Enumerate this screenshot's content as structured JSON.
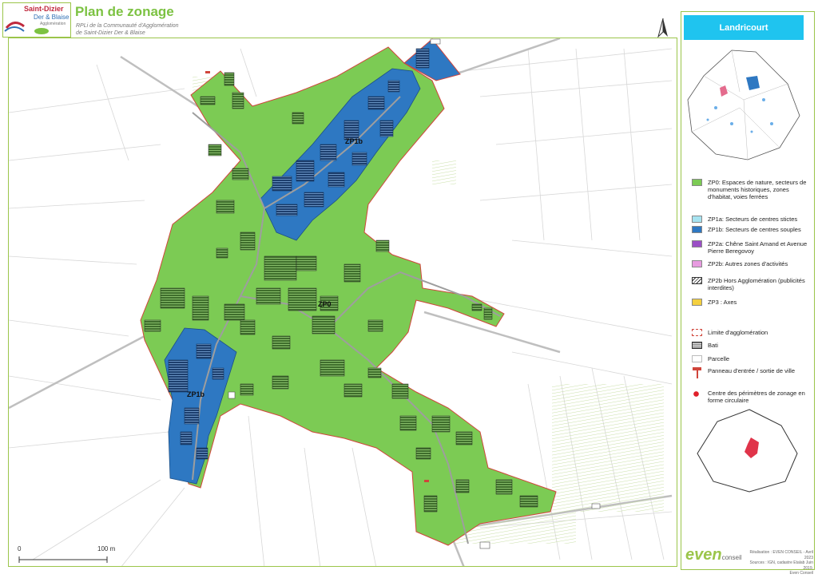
{
  "logo": {
    "line1": "Saint-Dizier",
    "line2": "Der & Blaise",
    "line3": "Agglomération"
  },
  "header": {
    "title": "Plan de zonage",
    "subtitle_line1": "RPLi de la Communauté d'Agglomération",
    "subtitle_line2": "de Saint-Dizier Der & Blaise"
  },
  "north_label": "N",
  "commune_name": "Landricourt",
  "map_labels": {
    "zp1b_top": "ZP1b",
    "zp0": "ZP0",
    "zp1b_bottom": "ZP1b"
  },
  "legend": [
    {
      "label": "ZP0: Espaces de nature, secteurs de monuments historiques, zones d'habitat, voies ferrées",
      "color": "#7ccb54"
    },
    {
      "label": "ZP1a: Secteurs de centres stictes",
      "color": "#a6e3f0"
    },
    {
      "label": "ZP1b: Secteurs de centres souples",
      "color": "#2e78c2"
    },
    {
      "label": "ZP2a: Chêne Saint Amand et Avenue Pierre Beregovoy",
      "color": "#9b4fc6"
    },
    {
      "label": "ZP2b: Autres zones d'activités",
      "color": "#e79be0"
    },
    {
      "label": "ZP2b Hors Agglomération (publicités interdites)",
      "color": "hatch"
    },
    {
      "label": "ZP3 : Axes",
      "color": "#f4d03f"
    },
    {
      "label": "Limite d'agglomération",
      "color": "dashed-red"
    },
    {
      "label": "Bati",
      "color": "bati"
    },
    {
      "label": "Parcelle",
      "color": "parcelle"
    },
    {
      "label": "Panneau d'entrée / sortie de ville",
      "color": "sign"
    },
    {
      "label": "Centre des périmètres de zonage en forme circulaire",
      "color": "star"
    }
  ],
  "scale": {
    "start": "0",
    "end": "100 m"
  },
  "credits": {
    "line1": "Réalisation : EVEN CONSEIL - Avril 2023",
    "line2": "Sources : IGN, cadastre Etalab Juin 2019,",
    "line3": "Even Conseil"
  },
  "brand": {
    "name": "even",
    "sub": "conseil"
  }
}
